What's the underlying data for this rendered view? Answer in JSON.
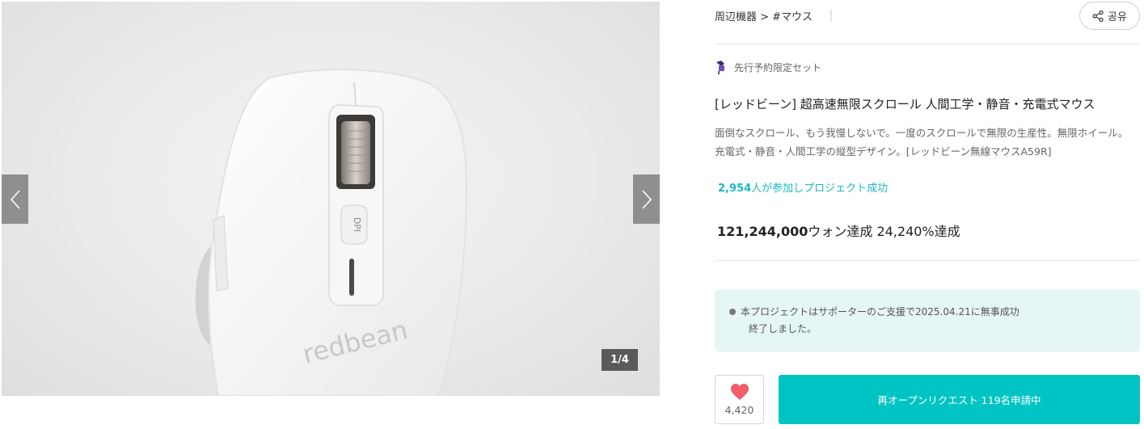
{
  "gallery": {
    "counter": "1/4",
    "prev_icon": "chevron-left-icon",
    "next_icon": "chevron-right-icon",
    "product_logo_text": "redbean"
  },
  "header": {
    "breadcrumb": "周辺機器 > #マウス",
    "share_label": "공유",
    "share_icon": "share-icon"
  },
  "product": {
    "preorder_label": "先行予約限定セット",
    "title": "[レッドビーン] 超高速無限スクロール 人間工学・静音・充電式マウス",
    "desc_line1": "面倒なスクロール、もう我慢しないで。一度のスクロールで無限の生産性。無限ホイール。",
    "desc_line2": "充電式・静音・人間工学の縦型デザイン。[レッドビーン無線マウスA59R]",
    "supporters_count": "2,954",
    "supporters_text": "人が参加しプロジェクト成功",
    "amount_value": "121,244,000",
    "amount_text": "ウォン達成 24,240%達成"
  },
  "notice": {
    "line1": "本プロジェクトはサポーターのご支援で2025.04.21に無事成功",
    "line2": "終了しました。"
  },
  "actions": {
    "like_count": "4,420",
    "reopen_label": "再オープンリクエスト 119名申請中"
  },
  "colors": {
    "accent": "#00c4c4",
    "accent_text": "#1cb9c0",
    "heart": "#f25c6b",
    "notice_bg": "#e6f6f7"
  }
}
